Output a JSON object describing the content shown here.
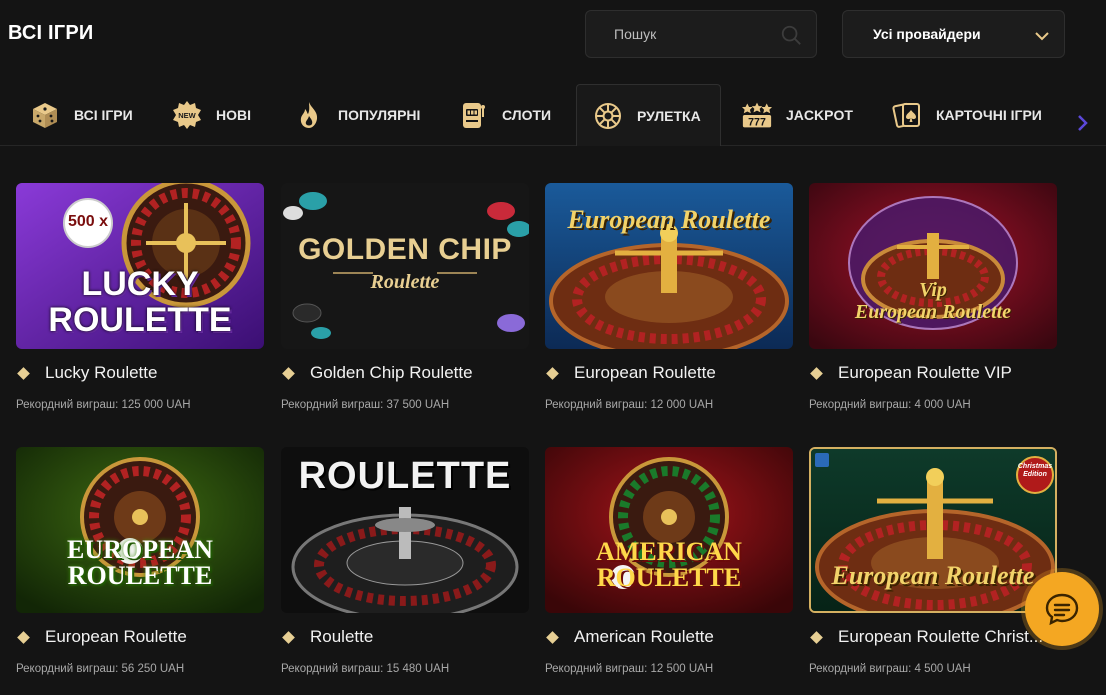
{
  "header": {
    "title": "ВСІ ІГРИ",
    "search_placeholder": "Пошук",
    "provider_label": "Усі провайдери"
  },
  "tabs": [
    {
      "label": "ВСІ ІГРИ",
      "icon": "dice-icon",
      "active": false
    },
    {
      "label": "НОВІ",
      "icon": "new-badge-icon",
      "active": false
    },
    {
      "label": "ПОПУЛЯРНІ",
      "icon": "fire-icon",
      "active": false
    },
    {
      "label": "СЛОТИ",
      "icon": "slot-machine-icon",
      "active": false
    },
    {
      "label": "РУЛЕТКА",
      "icon": "roulette-icon",
      "active": true
    },
    {
      "label": "JACKPOT",
      "icon": "jackpot-777-icon",
      "active": false
    },
    {
      "label": "КАРТОЧНІ ІГРИ",
      "icon": "cards-icon",
      "active": false
    }
  ],
  "games": [
    {
      "name": "Lucky Roulette",
      "record": "Рекордний виграш: 125 000 UAH",
      "art_text": [
        "LUCKY",
        "ROULETTE"
      ],
      "badge": "500 x"
    },
    {
      "name": "Golden Chip Roulette",
      "record": "Рекордний виграш: 37 500 UAH",
      "art_text": [
        "GOLDEN CHIP",
        "Roulette"
      ]
    },
    {
      "name": "European Roulette",
      "record": "Рекордний виграш: 12 000 UAH",
      "art_text": [
        "European Roulette"
      ]
    },
    {
      "name": "European Roulette VIP",
      "record": "Рекордний виграш: 4 000 UAH",
      "art_text": [
        "Vip",
        "European Roulette"
      ]
    },
    {
      "name": "European Roulette",
      "record": "Рекордний виграш: 56 250 UAH",
      "art_text": [
        "EUROPEAN",
        "ROULETTE"
      ]
    },
    {
      "name": "Roulette",
      "record": "Рекордний виграш: 15 480 UAH",
      "art_text": [
        "ROULETTE"
      ]
    },
    {
      "name": "American Roulette",
      "record": "Рекордний виграш: 12 500 UAH",
      "art_text": [
        "AMERICAN",
        "ROULETTE"
      ]
    },
    {
      "name": "European Roulette Christ...",
      "record": "Рекордний виграш: 4 500 UAH",
      "art_text": [
        "European Roulette"
      ],
      "badge": "Christmas Edition"
    }
  ],
  "colors": {
    "background": "#141414",
    "accent_gold": "#e7cf94",
    "chat_button": "#f4a722",
    "tab_icon_gold": "#e9c98a"
  }
}
